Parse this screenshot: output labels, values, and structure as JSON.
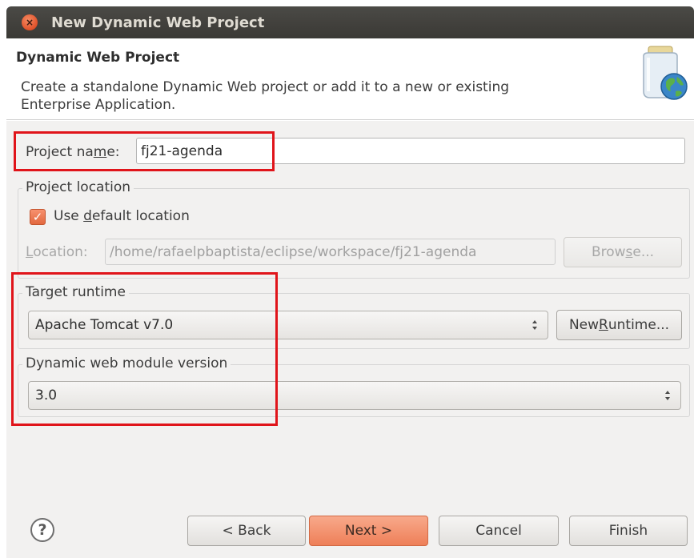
{
  "window": {
    "title": "New Dynamic Web Project",
    "close_glyph": "×"
  },
  "header": {
    "title": "Dynamic Web Project",
    "description_line1": "Create a standalone Dynamic Web project or add it to a new or existing",
    "description_line2": "Enterprise Application.",
    "icon": "jar-globe-icon"
  },
  "project_name": {
    "label_before": "Project na",
    "label_mnemonic": "m",
    "label_after": "e:",
    "value": "fj21-agenda"
  },
  "project_location": {
    "group_title": "Project location",
    "checkbox_checked": true,
    "checkbox_label_before": "Use ",
    "checkbox_label_mnemonic": "d",
    "checkbox_label_after": "efault location",
    "location_label_mnemonic": "L",
    "location_label_after": "ocation:",
    "location_value": "/home/rafaelpbaptista/eclipse/workspace/fj21-agenda",
    "browse_before": "Brow",
    "browse_mnemonic": "s",
    "browse_after": "e..."
  },
  "target_runtime": {
    "group_title": "Target runtime",
    "selected": "Apache Tomcat v7.0",
    "new_runtime_before": "New ",
    "new_runtime_mnemonic": "R",
    "new_runtime_after": "untime..."
  },
  "module_version": {
    "group_title": "Dynamic web module version",
    "selected": "3.0"
  },
  "footer": {
    "help_glyph": "?",
    "back_label": "< Back",
    "next_label": "Next >",
    "cancel_label": "Cancel",
    "finish_label": "Finish"
  },
  "colors": {
    "highlight_box": "#e0141a",
    "accent": "#ee7f58",
    "titlebar": "#3c3b37"
  }
}
